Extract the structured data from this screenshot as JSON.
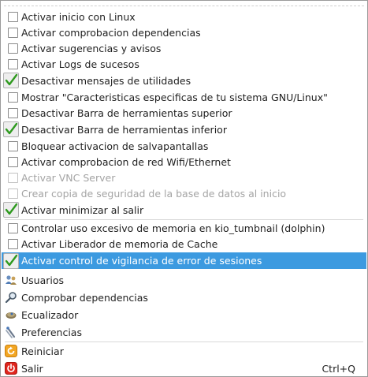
{
  "menu": {
    "items": [
      {
        "label": "Activar inicio con Linux",
        "checked": false,
        "enabled": true
      },
      {
        "label": "Activar comprobacion dependencias",
        "checked": false,
        "enabled": true
      },
      {
        "label": "Activar sugerencias y avisos",
        "checked": false,
        "enabled": true
      },
      {
        "label": "Activar Logs de sucesos",
        "checked": false,
        "enabled": true
      },
      {
        "label": "Desactivar mensajes de utilidades",
        "checked": true,
        "enabled": true
      },
      {
        "label": "Mostrar \"Caracteristicas especificas de tu sistema GNU/Linux\"",
        "checked": false,
        "enabled": true
      },
      {
        "label": "Desactivar Barra de herramientas superior",
        "checked": false,
        "enabled": true
      },
      {
        "label": "Desactivar Barra de herramientas inferior",
        "checked": true,
        "enabled": true
      },
      {
        "label": "Bloquear activacion de salvapantallas",
        "checked": false,
        "enabled": true
      },
      {
        "label": "Activar comprobacion de red Wifi/Ethernet",
        "checked": false,
        "enabled": true
      },
      {
        "label": "Activar VNC Server",
        "checked": false,
        "enabled": false
      },
      {
        "label": "Crear copia de seguridad de la base de datos al inicio",
        "checked": false,
        "enabled": false
      },
      {
        "label": "Activar minimizar al salir",
        "checked": true,
        "enabled": true
      },
      {
        "label": "Controlar uso excesivo de memoria en kio_tumbnail (dolphin)",
        "checked": false,
        "enabled": true
      },
      {
        "label": "Activar Liberador de memoria de Cache",
        "checked": false,
        "enabled": true
      },
      {
        "label": "Activar control de vigilancia de error de sesiones",
        "checked": true,
        "enabled": true,
        "highlighted": true
      }
    ],
    "actions": [
      {
        "label": "Usuarios",
        "icon": "users-icon"
      },
      {
        "label": "Comprobar dependencias",
        "icon": "magnifier-icon"
      },
      {
        "label": "Ecualizador",
        "icon": "equalizer-icon"
      },
      {
        "label": "Preferencias",
        "icon": "preferences-icon"
      }
    ],
    "restart": {
      "label": "Reiniciar",
      "icon": "restart-icon"
    },
    "quit": {
      "label": "Salir",
      "icon": "power-icon",
      "shortcut": "Ctrl+Q"
    }
  },
  "colors": {
    "highlight": "#3c9ae0",
    "check": "#2e9a1e",
    "disabled_text": "#a4a4a4"
  }
}
